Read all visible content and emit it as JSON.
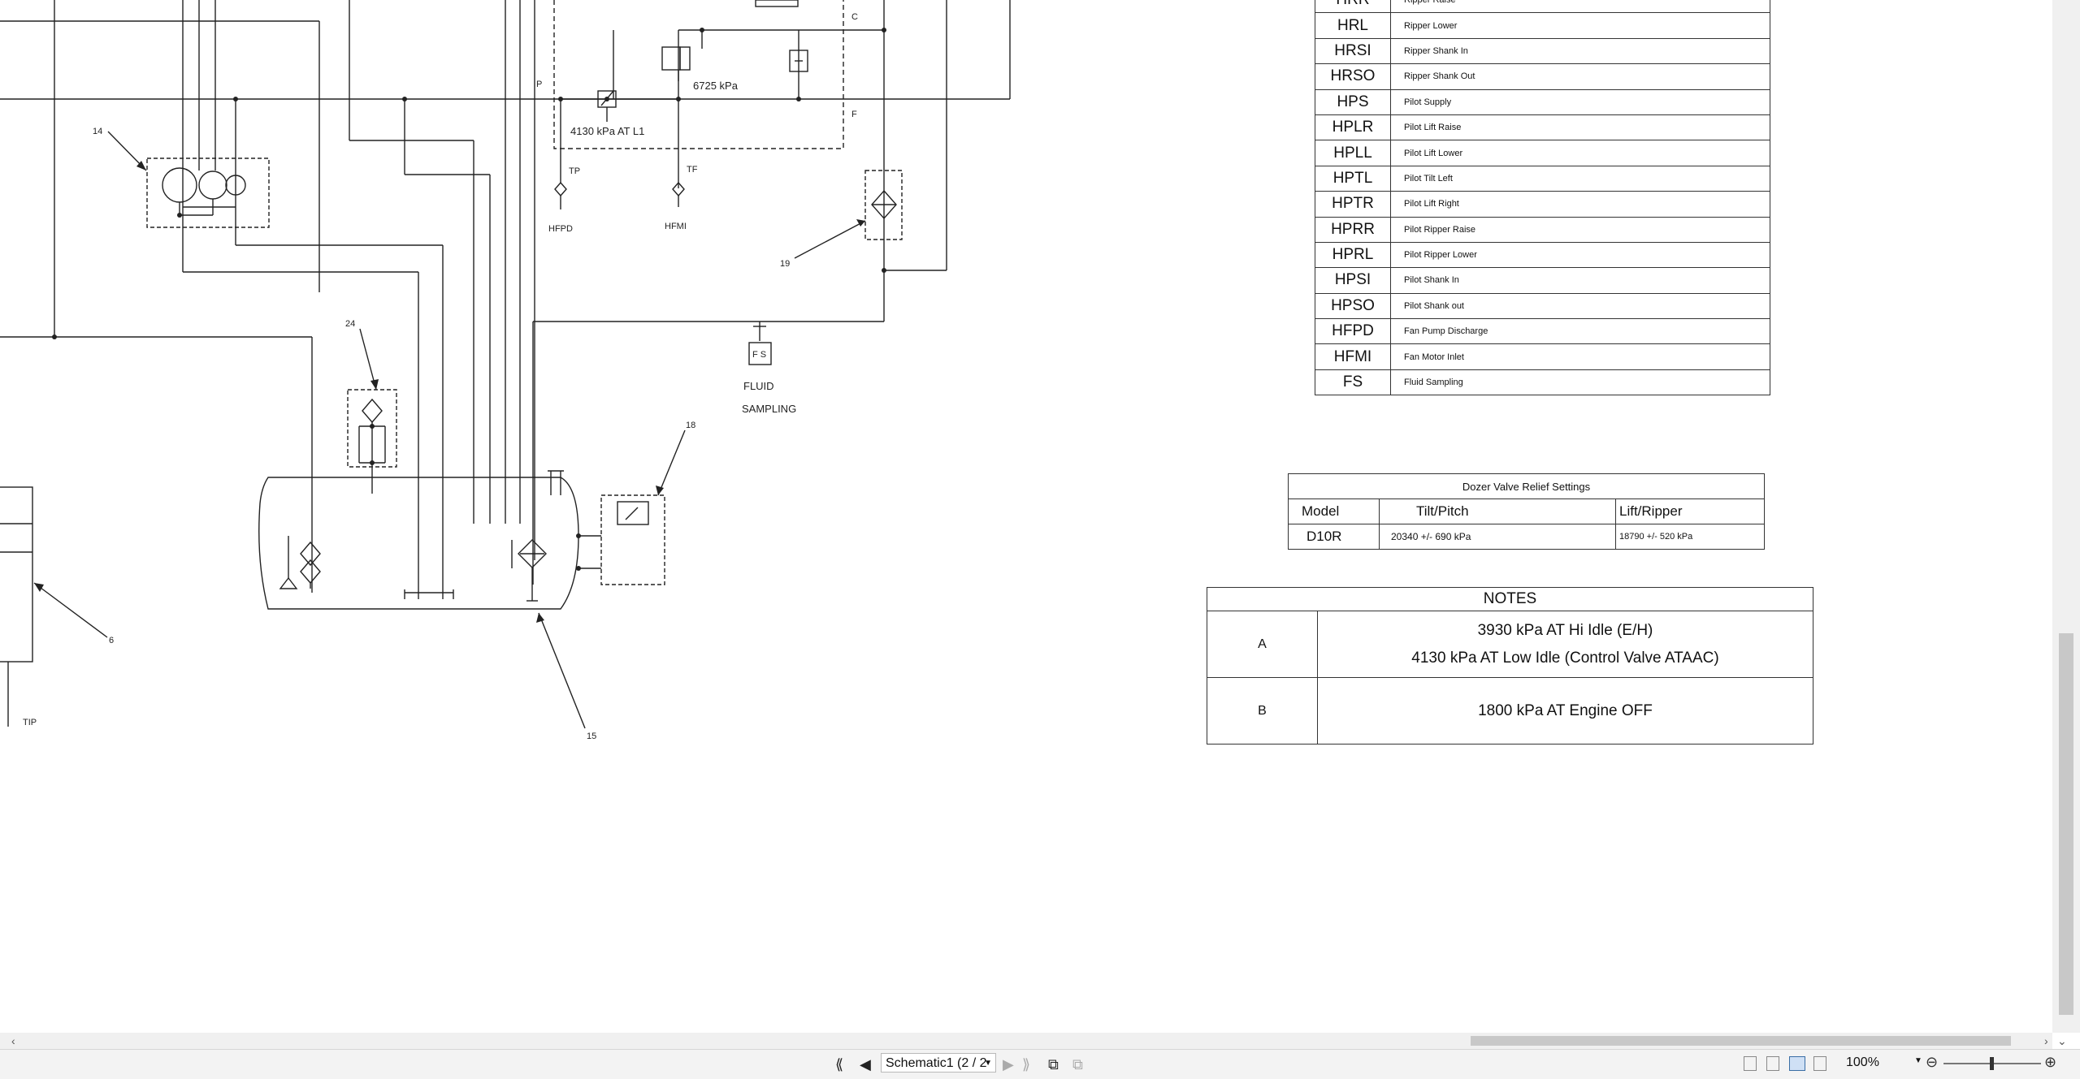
{
  "schematic": {
    "labels": {
      "p": "P",
      "c": "C",
      "f": "F",
      "relief_1": "4130 kPa AT L1",
      "relief_2": "6725 kPa",
      "tp": "TP",
      "tf": "TF",
      "hfpd": "HFPD",
      "hfmi": "HFMI",
      "fs": "F S",
      "fluid": "FLUID",
      "sampling": "SAMPLING",
      "tip": "TIP"
    },
    "callouts": [
      "14",
      "24",
      "19",
      "18",
      "6",
      "15"
    ]
  },
  "legend_table": [
    {
      "code": "HRR",
      "desc": "Ripper Raise"
    },
    {
      "code": "HRL",
      "desc": "Ripper Lower"
    },
    {
      "code": "HRSI",
      "desc": "Ripper Shank In"
    },
    {
      "code": "HRSO",
      "desc": "Ripper Shank Out"
    },
    {
      "code": "HPS",
      "desc": "Pilot Supply"
    },
    {
      "code": "HPLR",
      "desc": "Pilot Lift Raise"
    },
    {
      "code": "HPLL",
      "desc": "Pilot Lift Lower"
    },
    {
      "code": "HPTL",
      "desc": "Pilot Tilt Left"
    },
    {
      "code": "HPTR",
      "desc": "Pilot Lift Right"
    },
    {
      "code": "HPRR",
      "desc": "Pilot Ripper Raise"
    },
    {
      "code": "HPRL",
      "desc": "Pilot Ripper Lower"
    },
    {
      "code": "HPSI",
      "desc": "Pilot Shank In"
    },
    {
      "code": "HPSO",
      "desc": "Pilot Shank out"
    },
    {
      "code": "HFPD",
      "desc": "Fan Pump Discharge"
    },
    {
      "code": "HFMI",
      "desc": "Fan Motor Inlet"
    },
    {
      "code": "FS",
      "desc": "Fluid Sampling"
    }
  ],
  "relief_table": {
    "title": "Dozer Valve Relief Settings",
    "headers": [
      "Model",
      "Tilt/Pitch",
      "Lift/Ripper"
    ],
    "row": [
      "D10R",
      "20340 +/- 690 kPa",
      "18790 +/- 520 kPa"
    ]
  },
  "notes_table": {
    "title": "NOTES",
    "rows": [
      {
        "letter": "A",
        "lines": [
          "3930 kPa AT Hi Idle (E/H)",
          "4130 kPa AT Low Idle (Control Valve ATAAC)"
        ]
      },
      {
        "letter": "B",
        "lines": [
          "1800 kPa AT Engine OFF"
        ]
      }
    ]
  },
  "statusbar": {
    "sheet_label": "Schematic1 (2 / 2",
    "zoom": "100%"
  },
  "icons": {
    "first_page": "first-page-icon",
    "prev_page": "prev-page-icon",
    "next_page": "next-page-icon",
    "last_page": "last-page-icon",
    "new_window": "new-window-icon",
    "tile_windows": "tile-windows-icon"
  },
  "colors": {
    "line": "#222222",
    "dash": "#444444",
    "chrome": "#f0f0f0"
  }
}
